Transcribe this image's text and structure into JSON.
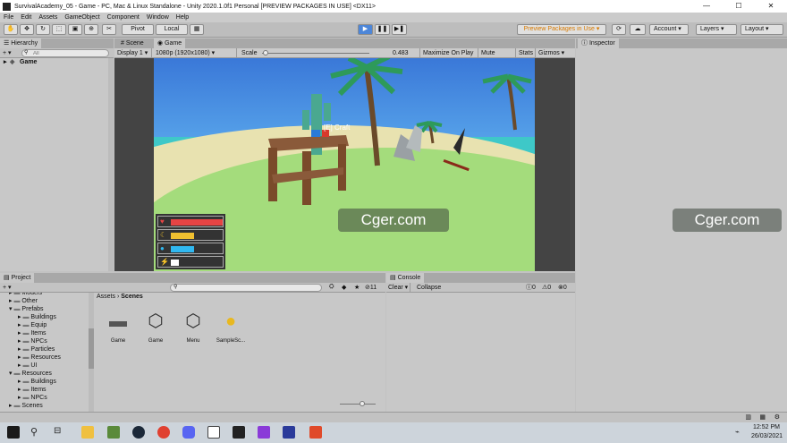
{
  "window": {
    "title": "SurvivalAcademy_05 - Game - PC, Mac & Linux Standalone - Unity 2020.1.0f1 Personal [PREVIEW PACKAGES IN USE] <DX11>",
    "minimize": "—",
    "maximize": "☐",
    "close": "✕"
  },
  "menu": [
    "File",
    "Edit",
    "Assets",
    "GameObject",
    "Component",
    "Window",
    "Help"
  ],
  "toolbar": {
    "pivot": "Pivot",
    "local": "Local",
    "preview": "Preview Packages in Use ▾",
    "account": "Account",
    "layers": "Layers",
    "layout": "Layout",
    "play": "▶",
    "pause": "❚❚",
    "step": "▶❚"
  },
  "hierarchy": {
    "tab": "Hierarchy",
    "add": "+ ▾",
    "search_placeholder": "All",
    "scene": "Game"
  },
  "scene_tabs": {
    "scene": "Scene",
    "game": "Game"
  },
  "gamebar": {
    "display": "Display 1",
    "resolution": "1080p (1920x1080)",
    "scale_label": "Scale",
    "scale_value": "0.483",
    "scale_fraction": 0.483,
    "maximize": "Maximize On Play",
    "mute": "Mute Audio",
    "stats": "Stats",
    "gizmos": "Gizmos"
  },
  "game_view": {
    "prompt": "[E] Craft"
  },
  "hud": {
    "bars": [
      {
        "icon": "heart-icon",
        "color": "#e64444",
        "level": 1.0
      },
      {
        "icon": "food-icon",
        "color": "#f0c030",
        "level": 0.45
      },
      {
        "icon": "water-icon",
        "color": "#30b8f0",
        "level": 0.45
      },
      {
        "icon": "energy-icon",
        "color": "#ffffff",
        "level": 0.15
      }
    ]
  },
  "inspector": {
    "tab": "Inspector"
  },
  "watermark": "Cger.com",
  "project": {
    "tab": "Project",
    "add": "+ ▾",
    "tree": [
      {
        "label": "Models",
        "indent": 1
      },
      {
        "label": "Other",
        "indent": 1
      },
      {
        "label": "Prefabs",
        "indent": 1,
        "open": true
      },
      {
        "label": "Buildings",
        "indent": 2
      },
      {
        "label": "Equip",
        "indent": 2
      },
      {
        "label": "Items",
        "indent": 2
      },
      {
        "label": "NPCs",
        "indent": 2
      },
      {
        "label": "Particles",
        "indent": 2
      },
      {
        "label": "Resources",
        "indent": 2
      },
      {
        "label": "UI",
        "indent": 2
      },
      {
        "label": "Resources",
        "indent": 1,
        "open": true
      },
      {
        "label": "Buildings",
        "indent": 2
      },
      {
        "label": "Items",
        "indent": 2
      },
      {
        "label": "NPCs",
        "indent": 2
      },
      {
        "label": "Scenes",
        "indent": 1
      }
    ],
    "breadcrumb_root": "Assets",
    "breadcrumb_sep": "›",
    "breadcrumb_current": "Scenes",
    "hidden_count": "11",
    "assets": [
      {
        "name": "Game",
        "icon": "folder-icon"
      },
      {
        "name": "Game",
        "icon": "unity-scene-icon"
      },
      {
        "name": "Menu",
        "icon": "unity-scene-icon"
      },
      {
        "name": "SampleSc...",
        "icon": "lighting-settings-icon"
      }
    ]
  },
  "console": {
    "tab": "Console",
    "clear": "Clear",
    "collapse": "Collapse",
    "info": "0",
    "warn": "0",
    "error": "0"
  },
  "taskbar": {
    "time": "12:52 PM",
    "date": "26/03/2021"
  }
}
